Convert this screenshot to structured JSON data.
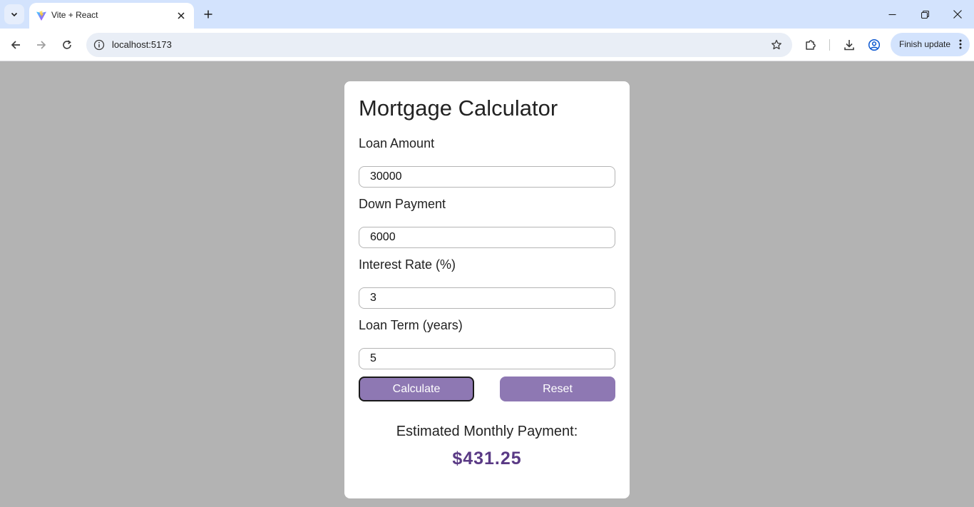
{
  "browser": {
    "tab": {
      "title": "Vite + React"
    },
    "address_bar": {
      "url": "localhost:5173"
    },
    "update_button": {
      "label": "Finish update"
    }
  },
  "calculator": {
    "title": "Mortgage Calculator",
    "fields": [
      {
        "label": "Loan Amount",
        "value": "30000"
      },
      {
        "label": "Down Payment",
        "value": "6000"
      },
      {
        "label": "Interest Rate (%)",
        "value": "3"
      },
      {
        "label": "Loan Term (years)",
        "value": "5"
      }
    ],
    "buttons": {
      "calculate": "Calculate",
      "reset": "Reset"
    },
    "result": {
      "label": "Estimated Monthly Payment:",
      "value": "$431.25"
    }
  },
  "colors": {
    "page_background": "#b3b3b3",
    "button": "#8e78b3",
    "result_value": "#5a3a85",
    "tabbar": "#d3e3fd"
  }
}
